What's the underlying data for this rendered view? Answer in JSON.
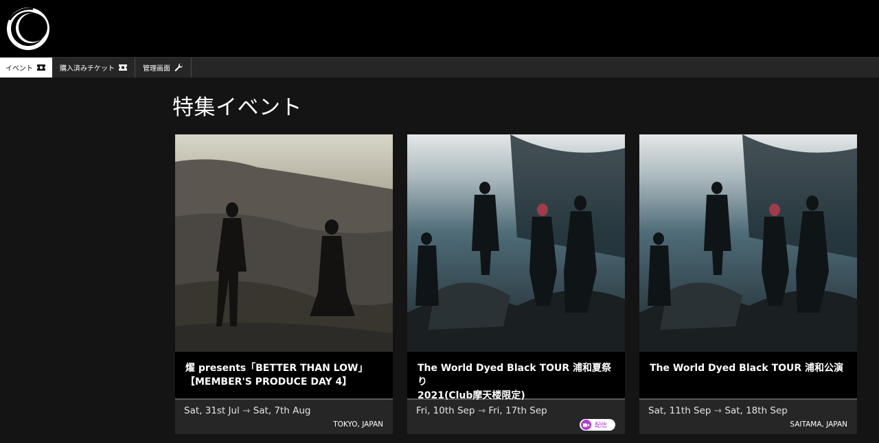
{
  "header": {
    "logo": "crescent-logo"
  },
  "nav": {
    "items": [
      {
        "label": "イベント",
        "icon": "ticket-icon",
        "active": true
      },
      {
        "label": "購入済みチケット",
        "icon": "ticket-icon",
        "active": false
      },
      {
        "label": "管理画面",
        "icon": "wrench-icon",
        "active": false
      }
    ]
  },
  "main": {
    "heading": "特集イベント",
    "cards": [
      {
        "title_line1": "燿 presents「BETTER THAN LOW」",
        "title_line2": "【MEMBER'S PRODUCE DAY 4】",
        "dates": "Sat, 31st Jul ⇾ Sat, 7th Aug",
        "location": "TOKYO, JAPAN",
        "badge": ""
      },
      {
        "title_line1": "The World Dyed Black TOUR 浦和夏祭り",
        "title_line2": "2021(Club摩天楼限定)",
        "dates": "Fri, 10th Sep ⇾ Fri, 17th Sep",
        "location": "",
        "badge": "配信"
      },
      {
        "title_line1": "The World Dyed Black TOUR 浦和公演",
        "title_line2": "",
        "dates": "Sat, 11th Sep ⇾ Sat, 18th Sep",
        "location": "SAITAMA, JAPAN",
        "badge": ""
      }
    ]
  },
  "colors": {
    "badge_accent": "#b33ccf",
    "page_bg": "#141414",
    "nav_bg": "#262626"
  }
}
